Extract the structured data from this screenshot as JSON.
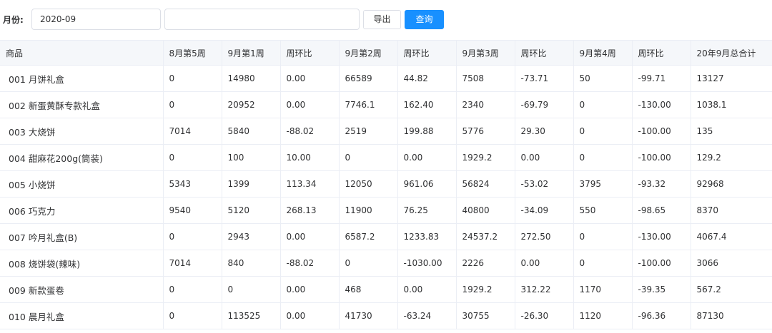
{
  "toolbar": {
    "month_label": "月份:",
    "month_value": "2020-09",
    "search_value": "",
    "export_label": "导出",
    "query_label": "查询"
  },
  "table": {
    "headers": [
      "商品",
      "8月第5周",
      "9月第1周",
      "周环比",
      "9月第2周",
      "周环比",
      "9月第3周",
      "周环比",
      "9月第4周",
      "周环比",
      "20年9月总合计"
    ],
    "rows": [
      [
        "001 月饼礼盒",
        "0",
        "14980",
        "0.00",
        "66589",
        "44.82",
        "7508",
        "-73.71",
        "50",
        "-99.71",
        "13127"
      ],
      [
        "002 新蛋黄酥专款礼盒",
        "0",
        "20952",
        "0.00",
        "7746.1",
        "162.40",
        "2340",
        "-69.79",
        "0",
        "-130.00",
        "1038.1"
      ],
      [
        "003 大烧饼",
        "7014",
        "5840",
        "-88.02",
        "2519",
        "199.88",
        "5776",
        "29.30",
        "0",
        "-100.00",
        "135"
      ],
      [
        "004 甜麻花200g(筒装)",
        "0",
        "100",
        "10.00",
        "0",
        "0.00",
        "1929.2",
        "0.00",
        "0",
        "-100.00",
        "129.2"
      ],
      [
        "005 小烧饼",
        "5343",
        "1399",
        "113.34",
        "12050",
        "961.06",
        "56824",
        "-53.02",
        "3795",
        "-93.32",
        "92968"
      ],
      [
        "006 巧克力",
        "9540",
        "5120",
        "268.13",
        "11900",
        "76.25",
        "40800",
        "-34.09",
        "550",
        "-98.65",
        "8370"
      ],
      [
        "007 吟月礼盒(B)",
        "0",
        "2943",
        "0.00",
        "6587.2",
        "1233.83",
        "24537.2",
        "272.50",
        "0",
        "-130.00",
        "4067.4"
      ],
      [
        "008 烧饼袋(辣味)",
        "7014",
        "840",
        "-88.02",
        "0",
        "-1030.00",
        "2226",
        "0.00",
        "0",
        "-100.00",
        "3066"
      ],
      [
        "009 新款蛋卷",
        "0",
        "0",
        "0.00",
        "468",
        "0.00",
        "1929.2",
        "312.22",
        "1170",
        "-39.35",
        "567.2"
      ],
      [
        "010 晨月礼盒",
        "0",
        "113525",
        "0.00",
        "41730",
        "-63.24",
        "30755",
        "-26.30",
        "1120",
        "-96.36",
        "87130"
      ]
    ]
  }
}
